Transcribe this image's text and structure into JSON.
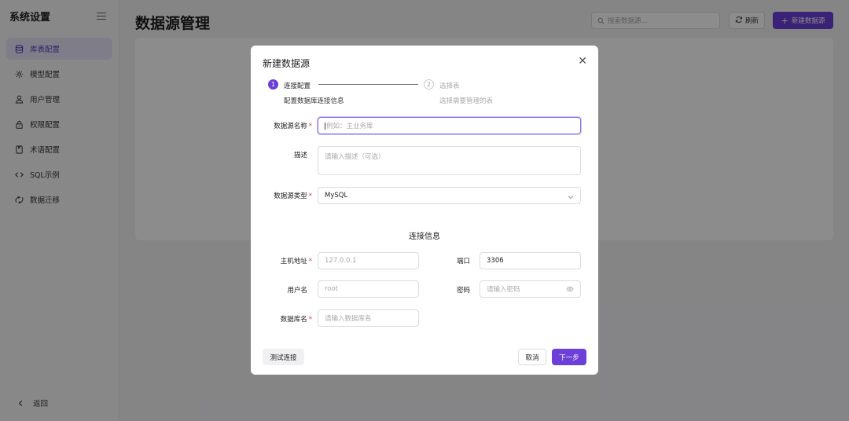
{
  "sidebar": {
    "title": "系统设置",
    "items": [
      {
        "label": "库表配置",
        "icon": "database-icon",
        "active": true
      },
      {
        "label": "模型配置",
        "icon": "gear-icon",
        "active": false
      },
      {
        "label": "用户管理",
        "icon": "user-icon",
        "active": false
      },
      {
        "label": "权限配置",
        "icon": "lock-icon",
        "active": false
      },
      {
        "label": "术语配置",
        "icon": "book-icon",
        "active": false
      },
      {
        "label": "SQL示例",
        "icon": "code-icon",
        "active": false
      },
      {
        "label": "数据迁移",
        "icon": "migrate-icon",
        "active": false
      }
    ],
    "back_label": "返回"
  },
  "header": {
    "page_title": "数据源管理",
    "search_placeholder": "搜索数据源...",
    "refresh_label": "刷新",
    "new_button_label": "新建数据源"
  },
  "modal": {
    "title": "新建数据源",
    "steps": [
      {
        "num": "1",
        "label": "连接配置",
        "desc": "配置数据库连接信息",
        "active": true
      },
      {
        "num": "2",
        "label": "选择表",
        "desc": "选择需要管理的表",
        "active": false
      }
    ],
    "form": {
      "name_label": "数据源名称",
      "name_placeholder": "例如：主业务库",
      "desc_label": "描述",
      "desc_placeholder": "请输入描述（可选）",
      "type_label": "数据源类型",
      "type_value": "MySQL",
      "section_title": "连接信息",
      "host_label": "主机地址",
      "host_placeholder": "127.0.0.1",
      "port_label": "端口",
      "port_value": "3306",
      "user_label": "用户名",
      "user_placeholder": "root",
      "password_label": "密码",
      "password_placeholder": "请输入密码",
      "db_label": "数据库名",
      "db_placeholder": "请输入数据库名"
    },
    "buttons": {
      "test": "测试连接",
      "cancel": "取消",
      "next": "下一步"
    }
  },
  "colors": {
    "accent": "#6b3fd8",
    "required": "#e0384a"
  }
}
